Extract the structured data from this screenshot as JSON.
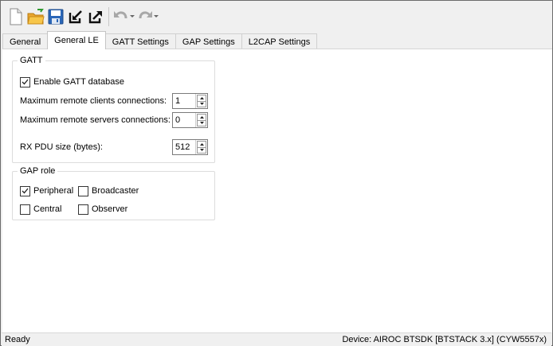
{
  "toolbar": {
    "icons": [
      "new-file-icon",
      "open-folder-icon",
      "save-icon",
      "import-icon",
      "export-icon",
      "undo-icon",
      "redo-icon"
    ]
  },
  "tabs": [
    {
      "label": "General",
      "active": false
    },
    {
      "label": "General LE",
      "active": true
    },
    {
      "label": "GATT Settings",
      "active": false
    },
    {
      "label": "GAP Settings",
      "active": false
    },
    {
      "label": "L2CAP Settings",
      "active": false
    }
  ],
  "gatt": {
    "title": "GATT",
    "enable_label": "Enable GATT database",
    "enable_checked": true,
    "remote_clients_label": "Maximum remote clients connections:",
    "remote_clients_value": "1",
    "remote_servers_label": "Maximum remote servers connections:",
    "remote_servers_value": "0",
    "rx_pdu_label": "RX PDU size (bytes):",
    "rx_pdu_value": "512"
  },
  "gap_role": {
    "title": "GAP role",
    "peripheral_label": "Peripheral",
    "peripheral_checked": true,
    "broadcaster_label": "Broadcaster",
    "broadcaster_checked": false,
    "central_label": "Central",
    "central_checked": false,
    "observer_label": "Observer",
    "observer_checked": false
  },
  "status": {
    "left": "Ready",
    "right": "Device: AIROC BTSDK [BTSTACK 3.x] (CYW5557x)"
  }
}
